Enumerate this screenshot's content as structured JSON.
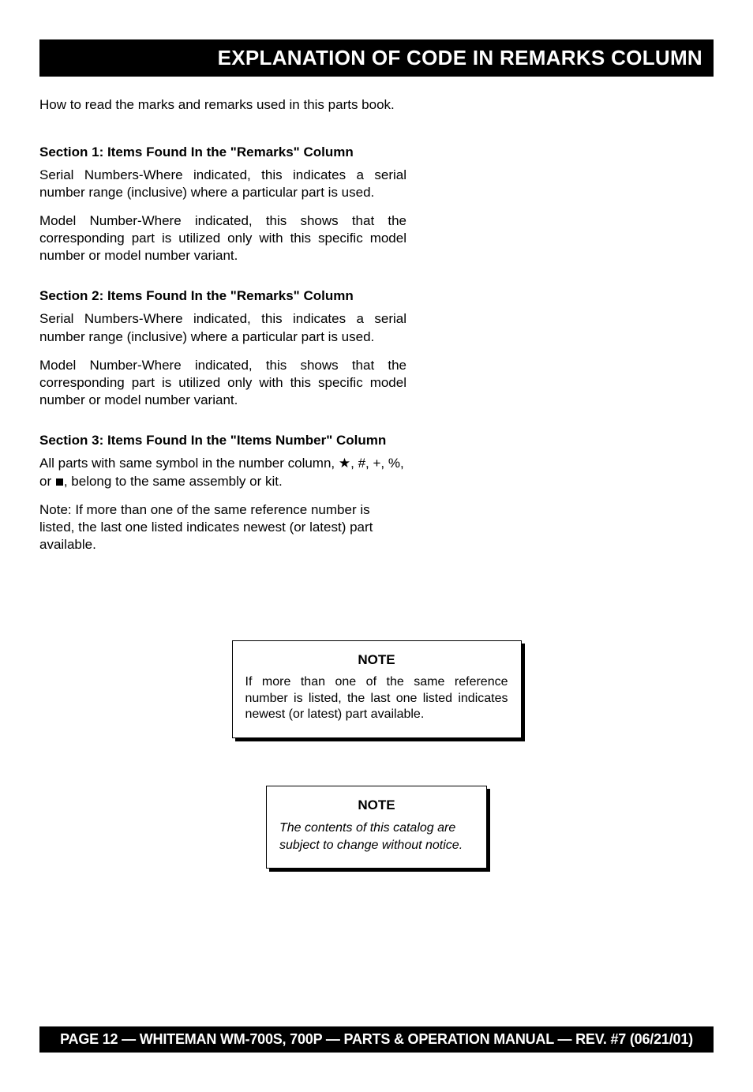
{
  "header": {
    "title": "EXPLANATION OF CODE IN REMARKS COLUMN"
  },
  "intro": "How to read the marks and remarks used in this parts book.",
  "sections": [
    {
      "heading": "Section 1: Items Found In the \"Remarks\" Column",
      "paragraphs": [
        "Serial Numbers-Where indicated, this indicates a serial number range (inclusive) where a particular part is used.",
        "Model Number-Where indicated, this shows that the corresponding part is utilized only with this specific model number or model number variant."
      ]
    },
    {
      "heading": "Section 2: Items Found In the \"Remarks\" Column",
      "paragraphs": [
        "Serial Numbers-Where indicated, this indicates a serial number range (inclusive) where a particular part is used.",
        "Model Number-Where indicated, this shows that the corresponding part is utilized only with this specific model number or model number variant."
      ]
    },
    {
      "heading": "Section 3: Items Found In the \"Items Number\" Column",
      "symbol_text_before": "All parts with same symbol in the number column, ",
      "symbol_text_after": ", belong to the same assembly or kit.",
      "symbols_middle": ", #, +, %, or ",
      "note": "Note: If more than one of the same reference number is listed, the last one listed indicates newest (or latest) part available."
    }
  ],
  "note_boxes": [
    {
      "title": "NOTE",
      "body": "If more than one of the same reference number is listed, the last one listed indicates newest (or latest) part available."
    },
    {
      "title": "NOTE",
      "body": "The contents of this catalog are subject to change without notice."
    }
  ],
  "footer": {
    "text": "PAGE 12 — WHITEMAN WM-700S, 700P — PARTS & OPERATION MANUAL — REV. #7 (06/21/01)"
  }
}
